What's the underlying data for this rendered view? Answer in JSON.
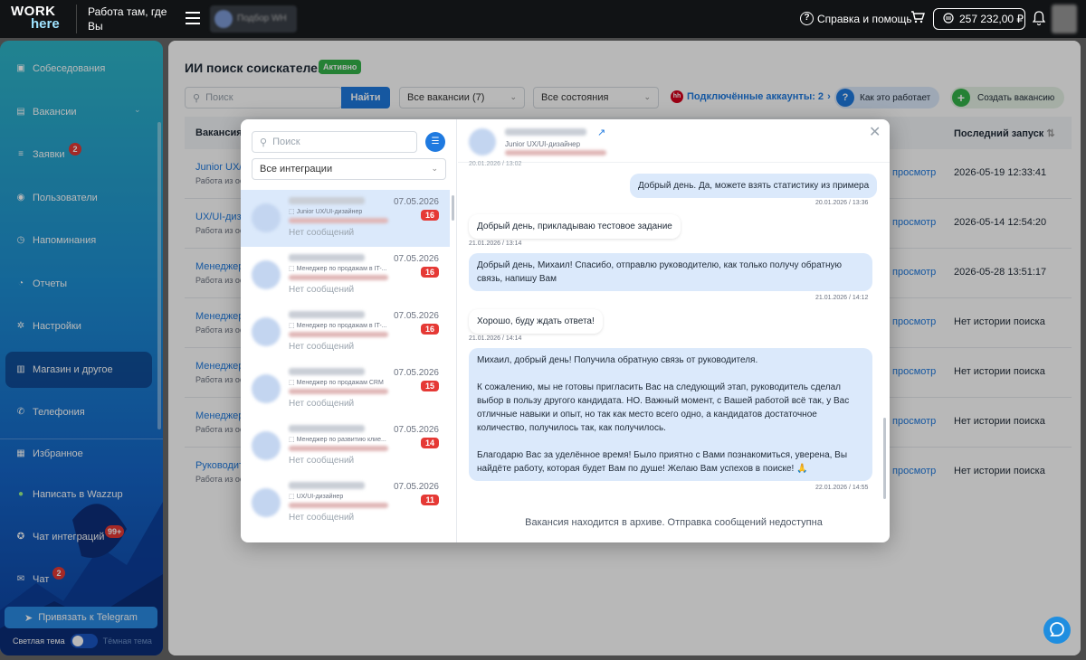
{
  "topbar": {
    "logo_line1": "WORK",
    "logo_line2": "here",
    "slogan": "Работа там, где Вы",
    "account_name": "Подбор WH",
    "help": "Справка и помощь",
    "balance": "257 232,00 ₽"
  },
  "sidebar": {
    "items": [
      {
        "label": "Собеседования",
        "icon": "calendar-icon"
      },
      {
        "label": "Вакансии",
        "icon": "briefcase-icon"
      },
      {
        "label": "Заявки",
        "icon": "list-icon",
        "badge": "2"
      },
      {
        "label": "Пользователи",
        "icon": "user-icon"
      },
      {
        "label": "Напоминания",
        "icon": "clock-icon"
      },
      {
        "label": "Отчеты",
        "icon": "pie-icon"
      },
      {
        "label": "Настройки",
        "icon": "gear-icon"
      },
      {
        "label": "Магазин и другое",
        "icon": "shop-icon"
      },
      {
        "label": "Телефония",
        "icon": "phone-icon"
      },
      {
        "label": "Избранное",
        "icon": "grid-icon"
      },
      {
        "label": "Написать в Wazzup",
        "icon": "wazzup-icon"
      },
      {
        "label": "Чат интеграций",
        "icon": "chat-icon",
        "badge": "99+"
      },
      {
        "label": "Чат",
        "icon": "chat-bubble-icon",
        "badge": "2"
      }
    ],
    "telegram_button": "Привязать к Telegram",
    "theme_light": "Светлая тема",
    "theme_dark": "Тёмная тема"
  },
  "main": {
    "title": "ИИ поиск соискателей",
    "status": "Активно",
    "search_placeholder": "Поиск",
    "search_button": "Найти",
    "filter_vacancies": "Все вакансии (7)",
    "filter_states": "Все состояния",
    "hh_logo": "hh",
    "connected_accounts": "Подключённые аккаунты: 2",
    "how_it_works": "Как это работает",
    "create_vacancy": "Создать вакансию",
    "col_vacancy": "Вакансия",
    "col_last_run": "Последний запуск",
    "rows": [
      {
        "title": "Junior UX/",
        "sub": "Работа из ос",
        "action": "просмотр",
        "last": "2026-05-19 12:33:41"
      },
      {
        "title": "UX/UI-дизай",
        "sub": "Работа из ос",
        "action": "просмотр",
        "last": "2026-05-14 12:54:20"
      },
      {
        "title": "Менеджер",
        "sub": "Работа из ос",
        "action": "просмотр",
        "last": "2026-05-28 13:51:17"
      },
      {
        "title": "Менеджер",
        "sub": "Работа из ос",
        "action": "просмотр",
        "last": "Нет истории поиска"
      },
      {
        "title": "Менеджер",
        "sub": "Работа из ос",
        "action": "просмотр",
        "last": "Нет истории поиска"
      },
      {
        "title": "Менеджер",
        "sub": "Работа из ос",
        "action": "просмотр",
        "last": "Нет истории поиска"
      },
      {
        "title": "Руководит",
        "sub": "Работа из ос",
        "action": "просмотр",
        "last": "Нет истории поиска"
      }
    ]
  },
  "modal": {
    "search_placeholder": "Поиск",
    "integrations": "Все интеграции",
    "conversations": [
      {
        "position": "Junior UX/UI-дизайнер",
        "date": "07.05.2026",
        "count": "16",
        "status": "Нет сообщений"
      },
      {
        "position": "Менеджер по продажам в IT-...",
        "date": "07.05.2026",
        "count": "16",
        "status": "Нет сообщений"
      },
      {
        "position": "Менеджер по продажам в IT-...",
        "date": "07.05.2026",
        "count": "16",
        "status": "Нет сообщений"
      },
      {
        "position": "Менеджер по продажам CRM",
        "date": "07.05.2026",
        "count": "15",
        "status": "Нет сообщений"
      },
      {
        "position": "Менеджер по развитию клие...",
        "date": "07.05.2026",
        "count": "14",
        "status": "Нет сообщений"
      },
      {
        "position": "UX/UI-дизайнер",
        "date": "07.05.2026",
        "count": "11",
        "status": "Нет сообщений"
      }
    ],
    "chat": {
      "position": "Junior UX/UI-дизайнер",
      "top_timestamp": "20.01.2026 / 13:02",
      "messages": [
        {
          "dir": "out",
          "text": "Добрый день. Да, можете взять статистику из примера",
          "time": "20.01.2026 / 13:36"
        },
        {
          "dir": "in",
          "text": "Добрый день, прикладываю тестовое задание",
          "time": "21.01.2026 / 13:14"
        },
        {
          "dir": "out",
          "text": "Добрый день, Михаил! Спасибо, отправлю руководителю, как только получу обратную связь, напишу Вам",
          "time": "21.01.2026 / 14:12"
        },
        {
          "dir": "in",
          "text": "Хорошо, буду ждать ответа!",
          "time": "21.01.2026 / 14:14"
        },
        {
          "dir": "out",
          "text": "Михаил, добрый день! Получила обратную связь от руководителя.\n\nК сожалению, мы не готовы пригласить Вас на следующий этап, руководитель сделал выбор в пользу другого кандидата. НО. Важный момент, с Вашей работой всё так, у Вас отличные навыки и опыт, но так как место всего одно, а кандидатов достаточное количество, получилось так, как получилось.\n\nБлагодарю Вас за уделённое время! Было приятно с Вами познакомиться, уверена, Вы найдёте работу, которая будет Вам по душе! Желаю Вам успехов в поиске! 🙏",
          "time": "22.01.2026 / 14:55"
        }
      ],
      "archive_notice": "Вакансия находится в архиве. Отправка сообщений недоступна"
    }
  },
  "colors": {
    "accent": "#1f7ae0",
    "success": "#34b34a",
    "badge": "#e53935"
  }
}
